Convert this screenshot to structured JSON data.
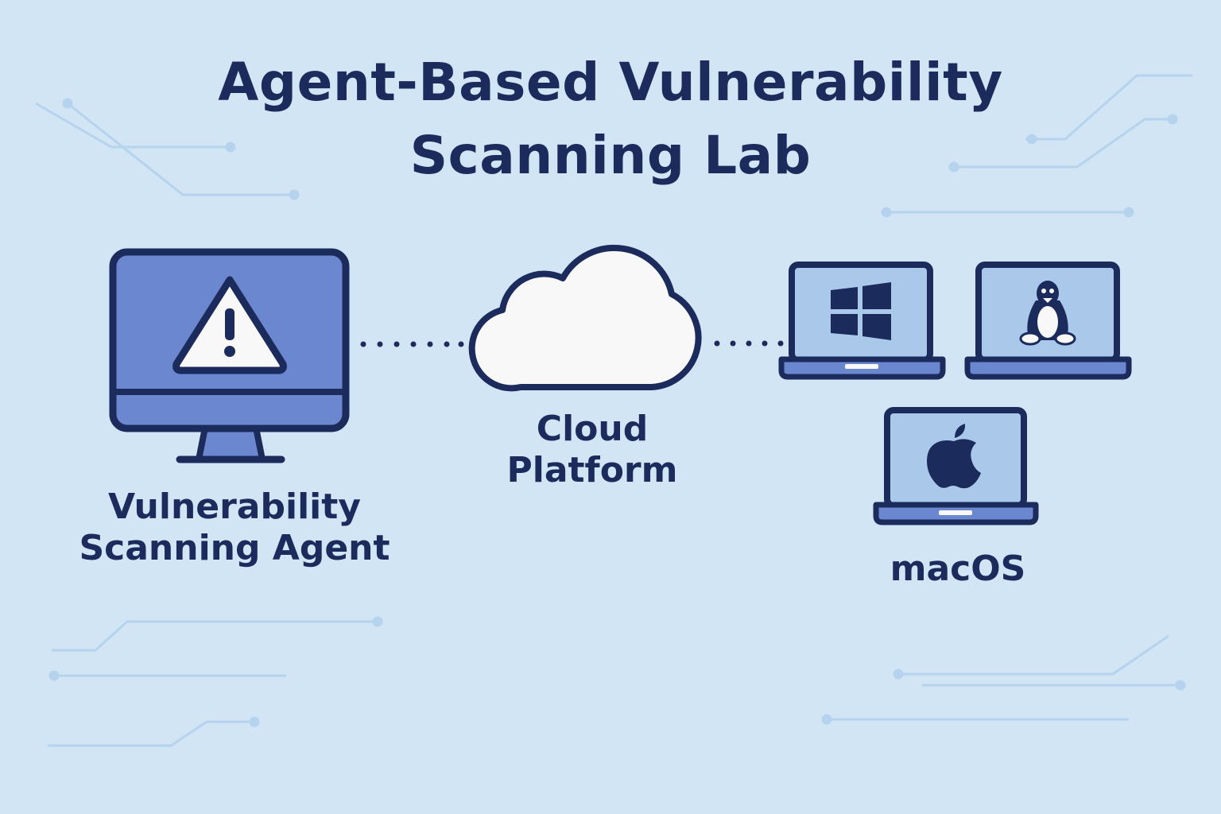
{
  "title": {
    "line1": "Agent-Based Vulnerability",
    "line2": "Scanning Lab"
  },
  "nodes": {
    "agent": {
      "line1": "Vulnerability",
      "line2": "Scanning Agent",
      "icon": "warning-icon"
    },
    "cloud": {
      "line1": "Cloud",
      "line2": "Platform",
      "icon": "cloud-icon"
    },
    "windows": {
      "icon": "windows-logo-icon"
    },
    "linux": {
      "icon": "linux-penguin-icon"
    },
    "macos": {
      "label": "macOS",
      "icon": "apple-logo-icon"
    }
  },
  "colors": {
    "background": "#d2e5f5",
    "outline": "#1b2b5c",
    "monitor_fill": "#6b87cf",
    "laptop_screen": "#a9c8ea",
    "laptop_base": "#6b87cf",
    "cloud_fill": "#f8f8f8",
    "circuit": "#b6d3ee"
  }
}
